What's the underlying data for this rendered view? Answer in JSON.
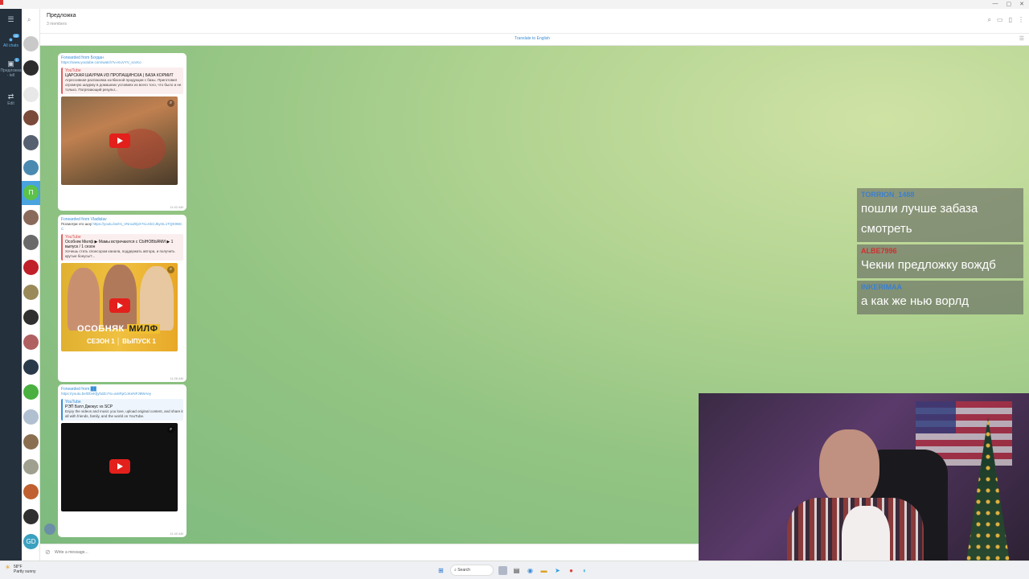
{
  "header": {
    "title": "Предложка",
    "subtitle": "3 members"
  },
  "translate_bar": {
    "label": "Translate to English"
  },
  "folders": [
    {
      "label": "All chats",
      "badge": "45",
      "active": true
    },
    {
      "label": "Предложка - tell",
      "badge": "1",
      "active": false
    },
    {
      "label": "Edit",
      "badge": "",
      "active": false
    }
  ],
  "messages": [
    {
      "forwarded_from": "Forwarded from Богдан",
      "link": "https://www.youtube.com/watch?v=KuVYV_sccKo",
      "preview_site": "YouTube",
      "preview_title": "ЦАРСКАЯ ШАУРМА ИЗ ПРОПАЩИНСКА | БАЗА КОРМИТ",
      "preview_desc": "Агрессивная распаковка колбасной продукции с базы. Приготовил огромную шаурму в домашних условиях из всего того, что было и не только. Погрязающий результ...",
      "time": "11:02 AM"
    },
    {
      "forwarded_from": "Forwarded from Vladislav",
      "text_prefix": "Посмотри это шоу",
      "link": "https://youtu.be/Hi_VNnoZIlpX?si=KkCJkymL1TQK9WcC",
      "preview_site": "YouTube",
      "preview_title": "Особняк Милф ▶ Мамы встречаются с СЫНОВЬЯМИ ▶ 1 выпуск / 1 сезон",
      "preview_desc": "Хочешь стать спонсором канала, поддержать автора, и получить крутые бонусы?...",
      "thumb_title_a": "ОСОБНЯК",
      "thumb_title_b": "МИЛФ",
      "thumb_sub_a": "СЕЗОН 1",
      "thumb_sub_b": "ВЫПУСК 1",
      "time": "11:26 AM"
    },
    {
      "forwarded_from": "Forwarded from ██",
      "link": "https://youtu.be/DbvKfjyhdZo?si=amRpCoKeNFJ8WAey",
      "preview_site": "YouTube",
      "preview_title": "РЭП Батл Джокус vs SCP",
      "preview_desc": "Enjoy the videos and music you love, upload original content, and share it all with friends, family, and the world on YouTube.",
      "time": "11:40 AM"
    }
  ],
  "composer": {
    "placeholder": "Write a message..."
  },
  "stream_chat": [
    {
      "user": "TORRION_1488",
      "text": "пошли лучше забаза смотреть",
      "color": "#3a7fd0"
    },
    {
      "user": "ALBE7996",
      "text": "Чекни предложку вождб",
      "color": "#d03030"
    },
    {
      "user": "INKERIMAA",
      "text": "а как же нью ворлд",
      "color": "#3a7fd0"
    }
  ],
  "taskbar": {
    "weather_temp": "58°F",
    "weather_desc": "Partly sunny",
    "search_label": "Search"
  },
  "colors": {
    "accent": "#4aa3df",
    "rail_bg": "#24303c",
    "youtube_red": "#e3201b"
  }
}
